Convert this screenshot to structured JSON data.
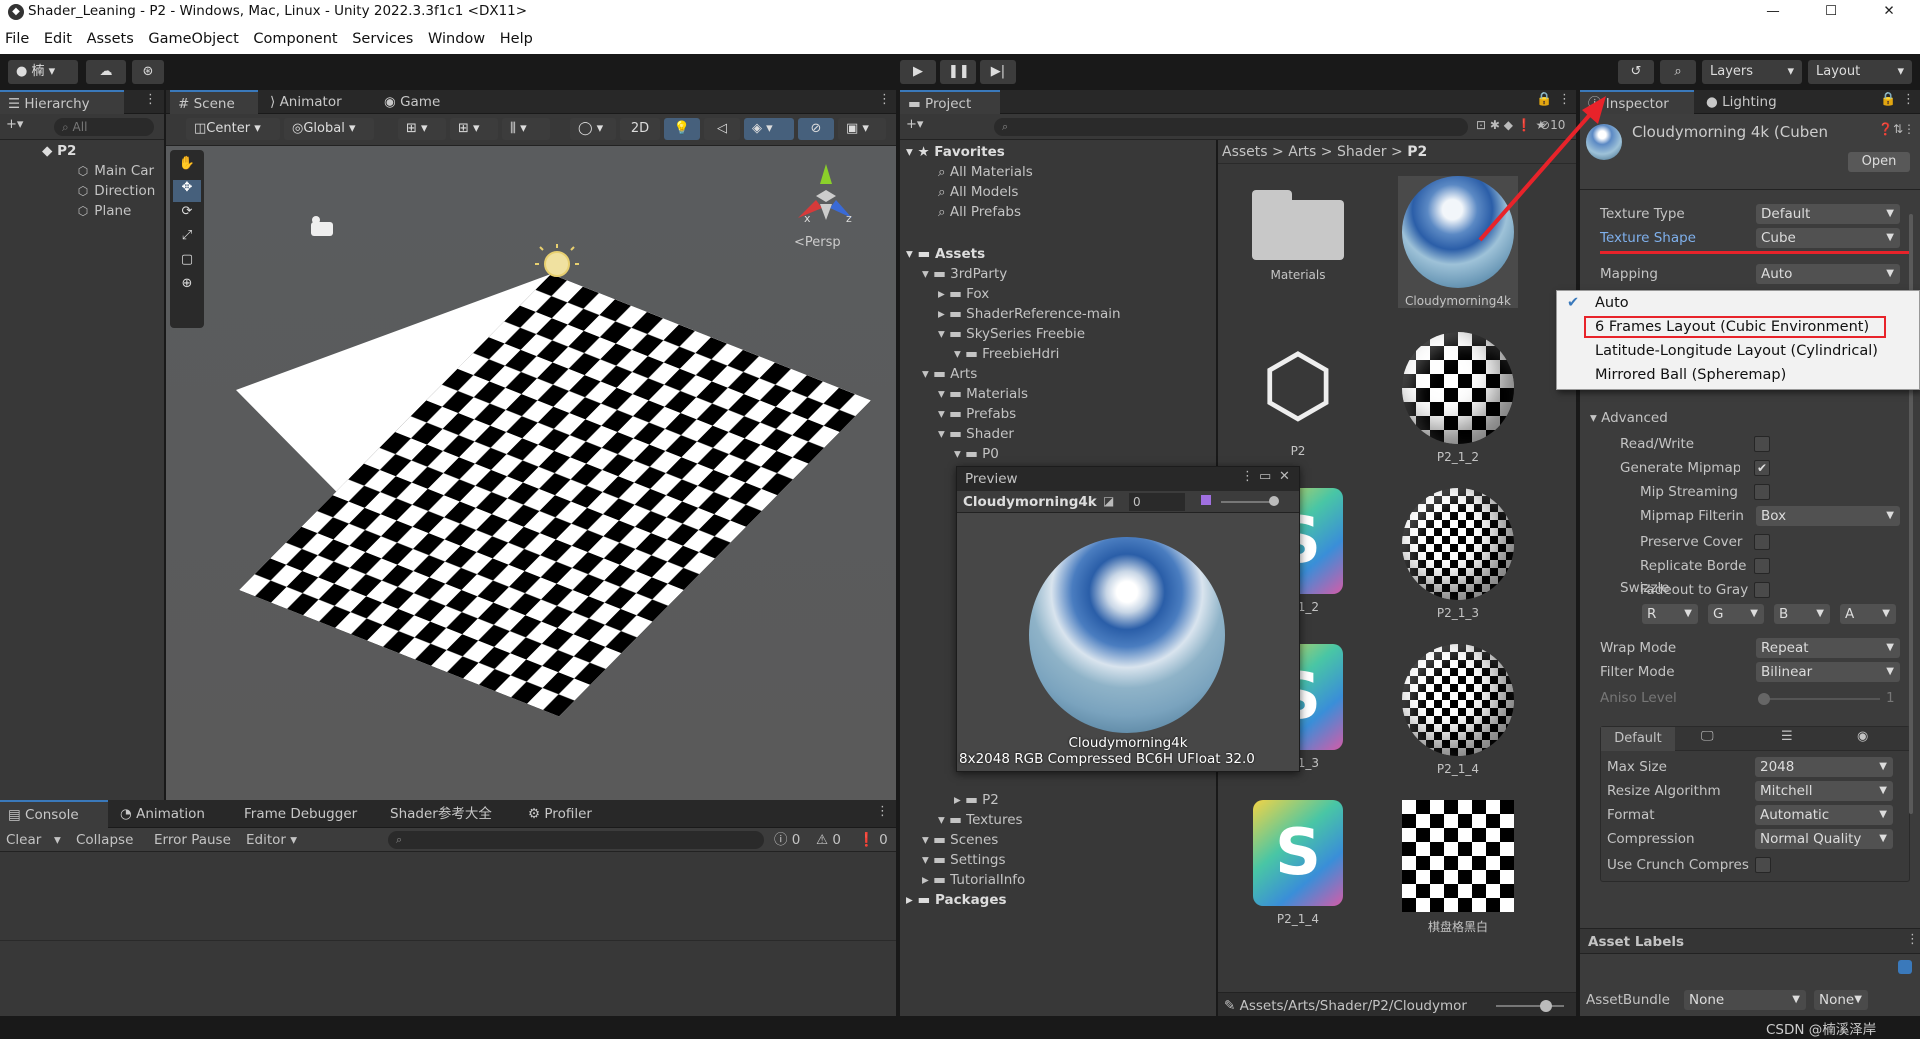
{
  "window": {
    "title": "Shader_Leaning - P2 - Windows, Mac, Linux - Unity 2022.3.3f1c1 <DX11>",
    "minimize": "—",
    "maximize": "☐",
    "close": "✕"
  },
  "menu": [
    "File",
    "Edit",
    "Assets",
    "GameObject",
    "Component",
    "Services",
    "Window",
    "Help"
  ],
  "toolbar": {
    "account": "楠",
    "layers": "Layers",
    "layout": "Layout"
  },
  "hierarchy": {
    "tab": "Hierarchy",
    "search": "All",
    "scene": "P2",
    "items": [
      "Main Car",
      "Direction",
      "Plane"
    ]
  },
  "scene": {
    "tabs": [
      "Scene",
      "Animator",
      "Game"
    ],
    "pivot": "Center",
    "space": "Global",
    "mode2d": "2D",
    "persp": "<Persp",
    "axis_x": "x",
    "axis_y": "y",
    "axis_z": "z"
  },
  "console": {
    "tabs": [
      "Console",
      "Animation",
      "Frame Debugger",
      "Shader参考大全",
      "Profiler"
    ],
    "clear": "Clear",
    "collapse": "Collapse",
    "error_pause": "Error Pause",
    "editor": "Editor",
    "counts": [
      "0",
      "0",
      "0"
    ]
  },
  "project": {
    "tab": "Project",
    "hidden_count": "10",
    "favorites": {
      "label": "Favorites",
      "items": [
        "All Materials",
        "All Models",
        "All Prefabs"
      ]
    },
    "assets_tree": [
      {
        "label": "Assets",
        "depth": 0
      },
      {
        "label": "3rdParty",
        "depth": 1
      },
      {
        "label": "Fox",
        "depth": 2
      },
      {
        "label": "ShaderReference-main",
        "depth": 2
      },
      {
        "label": "SkySeries Freebie",
        "depth": 2
      },
      {
        "label": "FreebieHdri",
        "depth": 3
      },
      {
        "label": "Arts",
        "depth": 1
      },
      {
        "label": "Materials",
        "depth": 2
      },
      {
        "label": "Prefabs",
        "depth": 2
      },
      {
        "label": "Shader",
        "depth": 2
      },
      {
        "label": "P0",
        "depth": 3
      }
    ],
    "assets_tree_lower": [
      {
        "label": "P2",
        "depth": 3
      },
      {
        "label": "Textures",
        "depth": 2
      },
      {
        "label": "Scenes",
        "depth": 1
      },
      {
        "label": "Settings",
        "depth": 1
      },
      {
        "label": "TutorialInfo",
        "depth": 1
      },
      {
        "label": "Packages",
        "depth": 0
      }
    ],
    "breadcrumb": [
      "Assets",
      "Arts",
      "Shader",
      "P2"
    ],
    "grid": [
      {
        "label": "Materials",
        "kind": "folder"
      },
      {
        "label": "Cloudymorning4k",
        "kind": "sky"
      },
      {
        "label": "P2",
        "kind": "unity"
      },
      {
        "label": "P2_1_2",
        "kind": "check"
      },
      {
        "label": "P2_1_2",
        "kind": "shader"
      },
      {
        "label": "P2_1_3",
        "kind": "check2"
      },
      {
        "label": "P2_1_3",
        "kind": "shader"
      },
      {
        "label": "P2_1_4",
        "kind": "check2"
      },
      {
        "label": "P2_1_4",
        "kind": "shader"
      },
      {
        "label": "棋盘格黑白",
        "kind": "board"
      }
    ],
    "path": "Assets/Arts/Shader/P2/Cloudymor"
  },
  "preview": {
    "title": "Preview",
    "asset": "Cloudymorning4k",
    "mip": "0",
    "caption": "Cloudymorning4k",
    "info": "8x2048  RGB Compressed BC6H UFloat  32.0"
  },
  "inspector": {
    "tabs": [
      "Inspector",
      "Lighting"
    ],
    "asset_title": "Cloudymorning 4k (Cuben",
    "open": "Open",
    "texture_type_label": "Texture Type",
    "texture_type": "Default",
    "texture_shape_label": "Texture Shape",
    "texture_shape": "Cube",
    "mapping_label": "Mapping",
    "mapping": "Auto",
    "advanced": "Advanced",
    "adv_rows": [
      {
        "label": "Read/Write",
        "checked": false
      },
      {
        "label": "Generate Mipmap",
        "checked": true
      },
      {
        "label": "Mip Streaming",
        "checked": false
      },
      {
        "label": "Mipmap Filterin",
        "value": "Box"
      },
      {
        "label": "Preserve Cover",
        "checked": false
      },
      {
        "label": "Replicate Borde",
        "checked": false
      },
      {
        "label": "Fadeout to Gray",
        "checked": false
      }
    ],
    "swizzle_label": "Swizzle",
    "swizzle": [
      "R",
      "G",
      "B",
      "A"
    ],
    "wrap_label": "Wrap Mode",
    "wrap": "Repeat",
    "filter_label": "Filter Mode",
    "filter": "Bilinear",
    "aniso_label": "Aniso Level",
    "aniso": "1",
    "platform_tab": "Default",
    "platform_rows": [
      {
        "label": "Max Size",
        "value": "2048"
      },
      {
        "label": "Resize Algorithm",
        "value": "Mitchell"
      },
      {
        "label": "Format",
        "value": "Automatic"
      },
      {
        "label": "Compression",
        "value": "Normal Quality"
      }
    ],
    "crunch_label": "Use Crunch Compres",
    "asset_labels": "Asset Labels",
    "assetbundle_label": "AssetBundle",
    "assetbundle": "None",
    "assetbundle_variant": "None"
  },
  "mapping_menu": {
    "items": [
      "Auto",
      "6 Frames Layout (Cubic Environment)",
      "Latitude-Longitude Layout (Cylindrical)",
      "Mirrored Ball (Spheremap)"
    ],
    "selected": 0,
    "highlighted": 1
  },
  "watermark": "CSDN @楠溪泽岸",
  "colors": {
    "accent": "#3a79bb",
    "annotation": "#e8232a"
  }
}
